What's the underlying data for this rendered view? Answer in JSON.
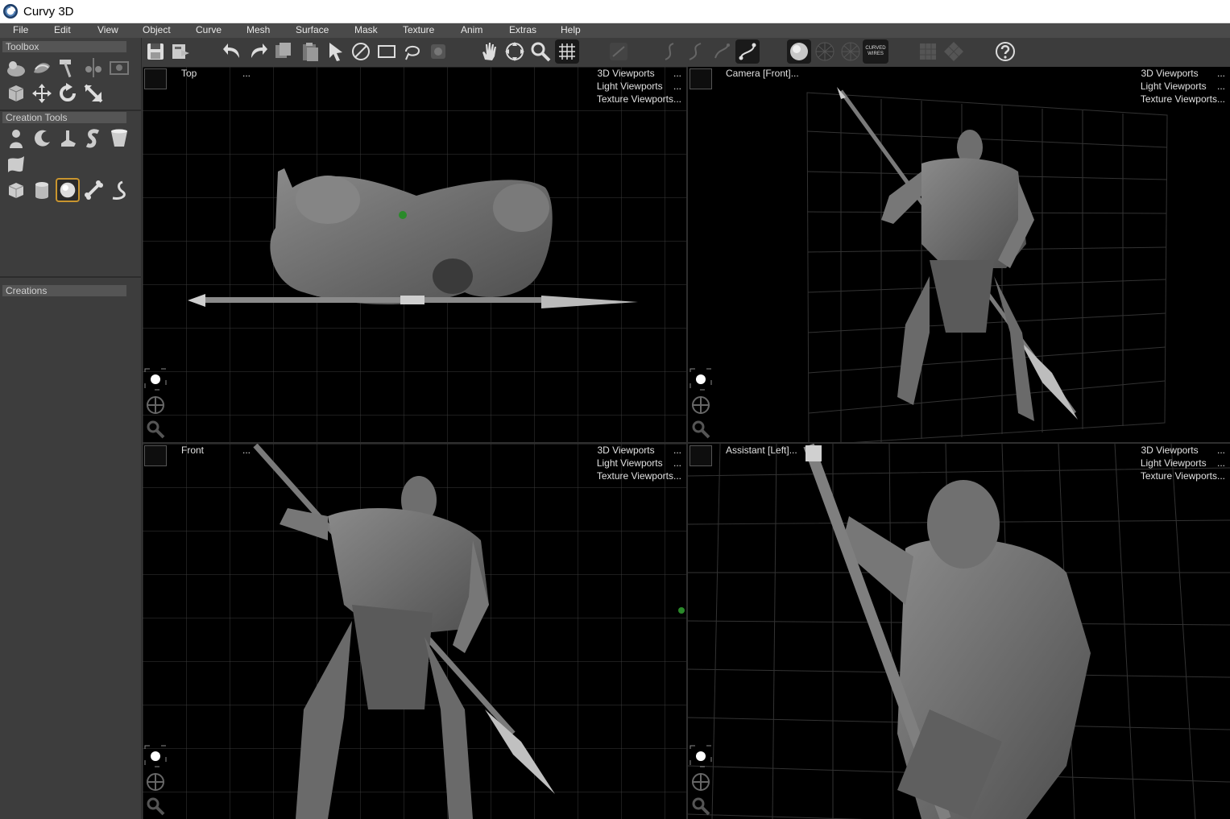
{
  "window": {
    "title": "Curvy 3D"
  },
  "menu": [
    "File",
    "Edit",
    "View",
    "Object",
    "Curve",
    "Mesh",
    "Surface",
    "Mask",
    "Texture",
    "Anim",
    "Extras",
    "Help"
  ],
  "toolbar": {
    "curved_wires_label": "CURVED WIRES"
  },
  "sidebar": {
    "toolbox_title": "Toolbox",
    "creation_tools_title": "Creation Tools",
    "creations_title": "Creations"
  },
  "viewports": [
    {
      "title": "Top",
      "dots": "...",
      "links": [
        "3D Viewports",
        "Light Viewports",
        "Texture Viewports..."
      ],
      "link_dots": [
        "...",
        "...",
        ""
      ]
    },
    {
      "title": "Camera [Front]...",
      "dots": "",
      "links": [
        "3D Viewports",
        "Light Viewports",
        "Texture Viewports..."
      ],
      "link_dots": [
        "...",
        "...",
        ""
      ]
    },
    {
      "title": "Front",
      "dots": "...",
      "links": [
        "3D Viewports",
        "Light Viewports",
        "Texture Viewports..."
      ],
      "link_dots": [
        "...",
        "...",
        ""
      ]
    },
    {
      "title": "Assistant [Left]...",
      "dots": "",
      "links": [
        "3D Viewports",
        "Light Viewports",
        "Texture Viewports..."
      ],
      "link_dots": [
        "...",
        "...",
        ""
      ]
    }
  ],
  "colors": {
    "accent": "#c9952f",
    "viewport_bg": "#000000",
    "grid": "#3a3a3a",
    "model": "#6e6e6e",
    "panel": "#3d3d3d"
  }
}
